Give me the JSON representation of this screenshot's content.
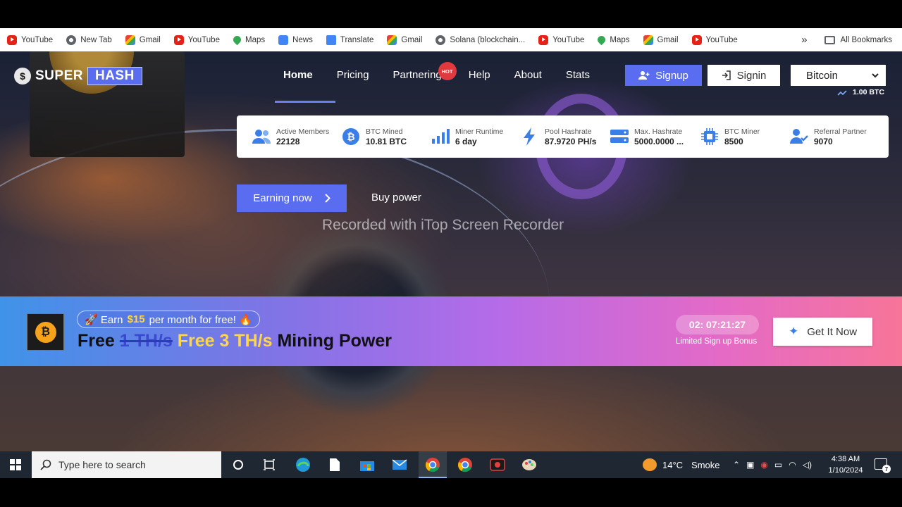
{
  "bookmarks": {
    "items": [
      {
        "label": "YouTube",
        "icon": "youtube-icon"
      },
      {
        "label": "New Tab",
        "icon": "globe-icon"
      },
      {
        "label": "Gmail",
        "icon": "gmail-icon"
      },
      {
        "label": "YouTube",
        "icon": "youtube-icon"
      },
      {
        "label": "Maps",
        "icon": "maps-icon"
      },
      {
        "label": "News",
        "icon": "news-icon"
      },
      {
        "label": "Translate",
        "icon": "translate-icon"
      },
      {
        "label": "Gmail",
        "icon": "gmail-icon"
      },
      {
        "label": "Solana (blockchain...",
        "icon": "globe-icon"
      },
      {
        "label": "YouTube",
        "icon": "youtube-icon"
      },
      {
        "label": "Maps",
        "icon": "maps-icon"
      },
      {
        "label": "Gmail",
        "icon": "gmail-icon"
      },
      {
        "label": "YouTube",
        "icon": "youtube-icon"
      }
    ],
    "overflow": "»",
    "all_bookmarks": "All Bookmarks"
  },
  "site": {
    "logo_part1": "SUPER",
    "logo_part2": "HASH",
    "nav": [
      "Home",
      "Pricing",
      "Partnering",
      "Help",
      "About",
      "Stats"
    ],
    "hot_badge": "HOT",
    "signup": "Signup",
    "signin": "Signin",
    "currency_selected": "Bitcoin",
    "btc_amount": "1.00 BTC",
    "accent_color": "#5a6cf0"
  },
  "stats": [
    {
      "label": "Active Members",
      "value": "22128",
      "icon": "users-icon"
    },
    {
      "label": "BTC Mined",
      "value": "10.81 BTC",
      "icon": "bitcoin-icon"
    },
    {
      "label": "Miner Runtime",
      "value": "6 day",
      "icon": "signal-icon"
    },
    {
      "label": "Pool Hashrate",
      "value": "87.9720 PH/s",
      "icon": "lightning-icon"
    },
    {
      "label": "Max. Hashrate",
      "value": "5000.0000 ...",
      "icon": "server-icon"
    },
    {
      "label": "BTC Miner",
      "value": "8500",
      "icon": "chip-icon"
    },
    {
      "label": "Referral Partner",
      "value": "9070",
      "icon": "user-check-icon"
    }
  ],
  "hero": {
    "earn_button": "Earning now",
    "buy_power": "Buy power",
    "watermark": "Recorded with iTop Screen Recorder"
  },
  "banner": {
    "pill_prefix": "🚀 Earn",
    "pill_amount": "$15",
    "pill_suffix": "per month for free! 🔥",
    "headline_free": "Free",
    "headline_strike": "1 TH/s",
    "headline_free3": "Free 3 TH/s",
    "headline_rest": "Mining Power",
    "timer": "02: 07:21:27",
    "timer_sub": "Limited Sign up Bonus",
    "cta": "Get It Now"
  },
  "taskbar": {
    "search_placeholder": "Type here to search",
    "weather_temp": "14°C",
    "weather_desc": "Smoke",
    "time": "4:38 AM",
    "date": "1/10/2024",
    "notification_count": "7"
  }
}
